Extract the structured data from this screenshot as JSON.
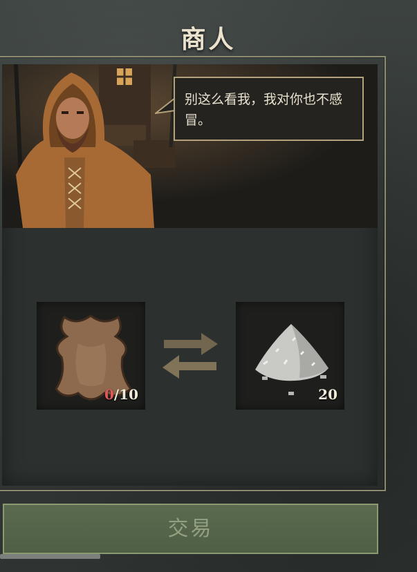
{
  "title": "商人",
  "merchant": {
    "dialogue": "别这么看我，我对你也不感冒。"
  },
  "trade": {
    "give": {
      "item_icon": "leather-hide-icon",
      "have": "0",
      "need": "/10"
    },
    "receive": {
      "item_icon": "salt-pile-icon",
      "quantity": "20"
    },
    "exchange_icon": "exchange-arrows-icon",
    "button_label": "交易"
  },
  "colors": {
    "insufficient": "#e0585a",
    "button_bg": "#566549",
    "frame": "#8e8a6e"
  }
}
